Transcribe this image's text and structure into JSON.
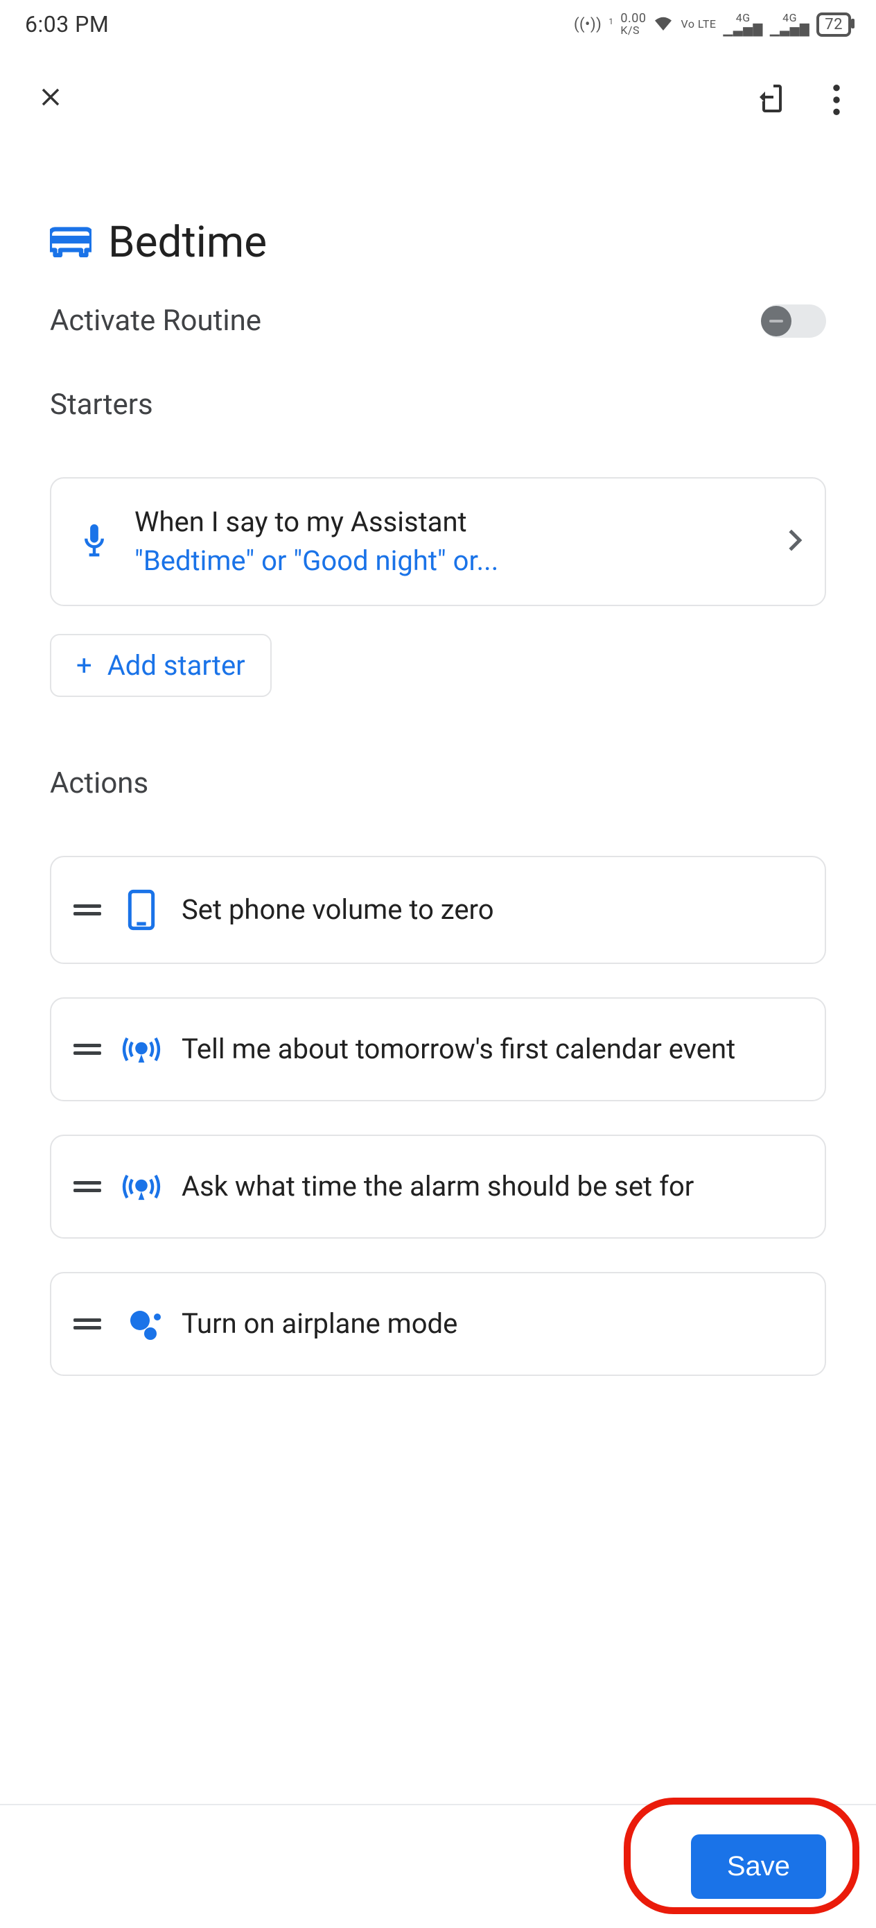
{
  "status": {
    "time": "6:03 PM",
    "speed": "0.00",
    "speed_unit": "K/S",
    "volte": "Vo LTE",
    "net1": "4G",
    "net2": "4G",
    "battery": "72"
  },
  "title": "Bedtime",
  "activate": "Activate Routine",
  "starters_header": "Starters",
  "starter": {
    "title": "When I say to my Assistant",
    "phrases": "\"Bedtime\" or \"Good night\" or..."
  },
  "add_starter": "Add starter",
  "actions_header": "Actions",
  "actions": [
    "Set phone volume to zero",
    "Tell me about tomorrow's first calendar event",
    "Ask what time the alarm should be set for",
    "Turn on airplane mode"
  ],
  "save": "Save"
}
